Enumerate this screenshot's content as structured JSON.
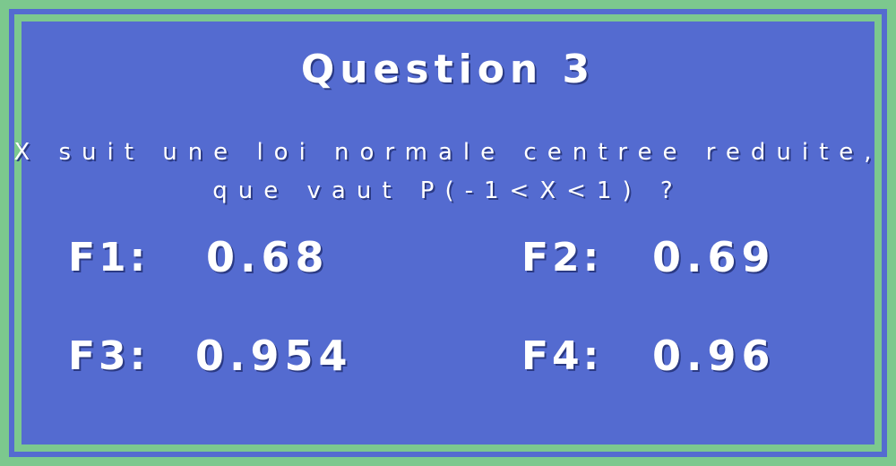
{
  "title": "Question 3",
  "question": {
    "line1": "X suit une loi normale centree reduite,",
    "line2": "que vaut P(-1<X<1) ?"
  },
  "answers": [
    {
      "label": "F1:",
      "value": "0.68"
    },
    {
      "label": "F2:",
      "value": "0.69"
    },
    {
      "label": "F3:",
      "value": "0.954"
    },
    {
      "label": "F4:",
      "value": "0.96"
    }
  ],
  "colors": {
    "background": "#546bd0",
    "border": "#7cc88e",
    "text": "#ffffff"
  }
}
